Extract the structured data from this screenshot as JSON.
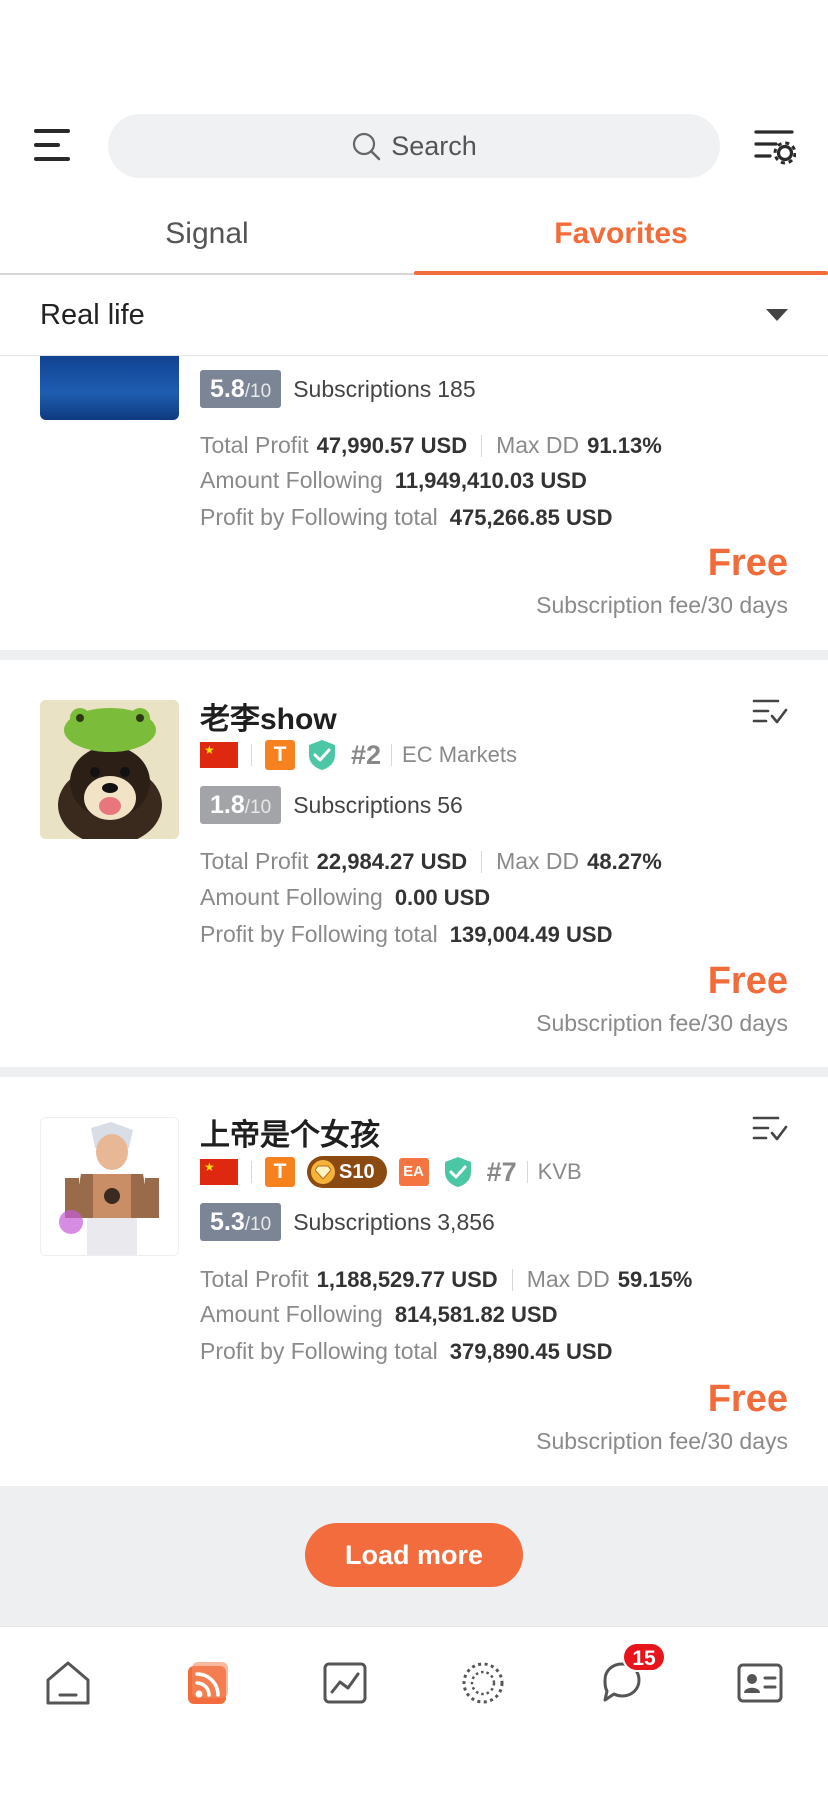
{
  "header": {
    "search_placeholder": "Search",
    "icons": [
      "menu-icon",
      "search-icon",
      "filter-settings-icon"
    ]
  },
  "tabs": [
    {
      "label": "Signal",
      "active": false
    },
    {
      "label": "Favorites",
      "active": true
    }
  ],
  "filter": {
    "selected": "Real life"
  },
  "accent_color": "#f26b3a",
  "traders": [
    {
      "name": "",
      "score": "5.8",
      "score_scale": "/10",
      "subscriptions_label": "Subscriptions",
      "subscriptions": "185",
      "total_profit_label": "Total Profit",
      "total_profit": "47,990.57 USD",
      "max_dd_label": "Max DD",
      "max_dd": "91.13%",
      "amount_following_label": "Amount Following",
      "amount_following": "11,949,410.03 USD",
      "profit_following_label": "Profit by Following total",
      "profit_following": "475,266.85 USD",
      "price": "Free",
      "fee_note": "Subscription fee/30 days"
    },
    {
      "name": "老李show",
      "rank": "#2",
      "broker": "EC Markets",
      "badge_t": "T",
      "score": "1.8",
      "score_scale": "/10",
      "subscriptions_label": "Subscriptions",
      "subscriptions": "56",
      "total_profit_label": "Total Profit",
      "total_profit": "22,984.27 USD",
      "max_dd_label": "Max DD",
      "max_dd": "48.27%",
      "amount_following_label": "Amount Following",
      "amount_following": "0.00 USD",
      "profit_following_label": "Profit by Following total",
      "profit_following": "139,004.49 USD",
      "price": "Free",
      "fee_note": "Subscription fee/30 days"
    },
    {
      "name": "上帝是个女孩",
      "rank": "#7",
      "broker": "KVB",
      "badge_t": "T",
      "badge_level": "S10",
      "badge_ea": "EA",
      "score": "5.3",
      "score_scale": "/10",
      "subscriptions_label": "Subscriptions",
      "subscriptions": "3,856",
      "total_profit_label": "Total Profit",
      "total_profit": "1,188,529.77 USD",
      "max_dd_label": "Max DD",
      "max_dd": "59.15%",
      "amount_following_label": "Amount Following",
      "amount_following": "814,581.82 USD",
      "profit_following_label": "Profit by Following total",
      "profit_following": "379,890.45 USD",
      "price": "Free",
      "fee_note": "Subscription fee/30 days"
    }
  ],
  "load_more_label": "Load more",
  "bottom_nav": [
    {
      "name": "home-icon",
      "active": false
    },
    {
      "name": "signals-feed-icon",
      "active": true
    },
    {
      "name": "chart-icon",
      "active": false
    },
    {
      "name": "community-icon",
      "active": false
    },
    {
      "name": "messages-icon",
      "active": false,
      "badge": "15"
    },
    {
      "name": "profile-card-icon",
      "active": false
    }
  ]
}
